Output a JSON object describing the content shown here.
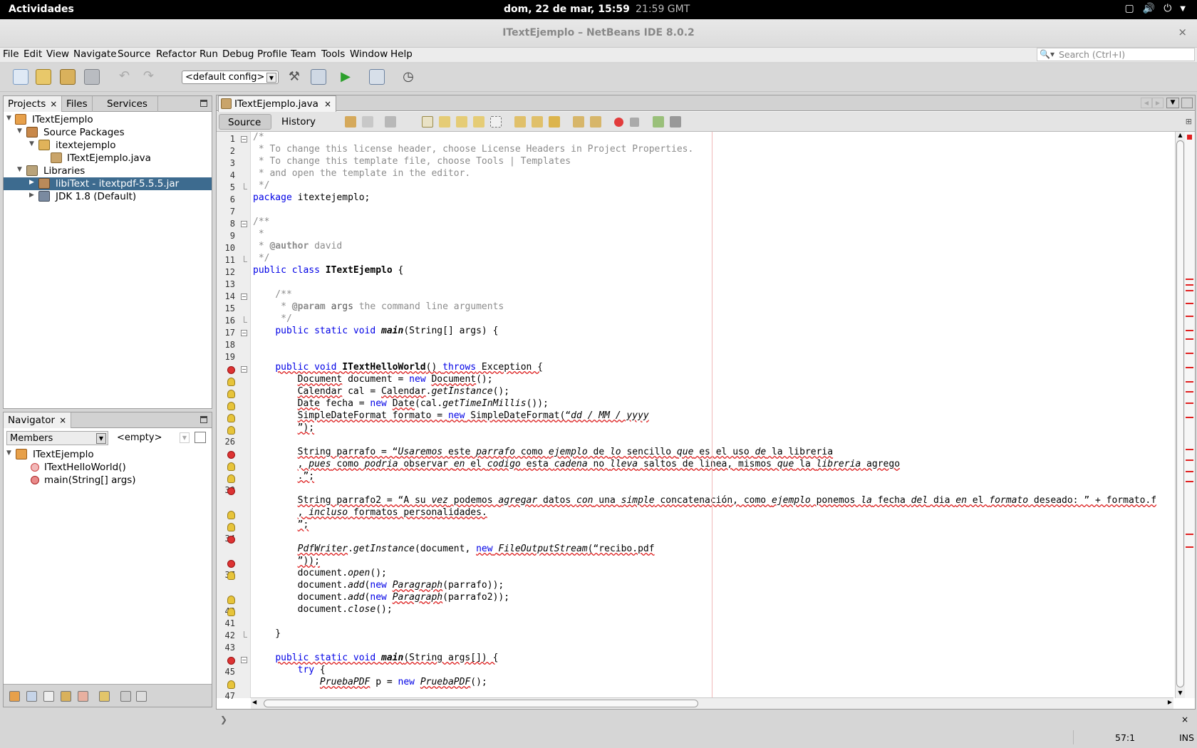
{
  "system_bar": {
    "activities": "Actividades",
    "clock": "dom, 22 de mar, 15:59",
    "gmt": "21:59 GMT"
  },
  "window": {
    "title": "ITextEjemplo – NetBeans IDE 8.0.2",
    "close": "×"
  },
  "menu": [
    "File",
    "Edit",
    "View",
    "Navigate",
    "Source",
    "Refactor",
    "Run",
    "Debug",
    "Profile",
    "Team",
    "Tools",
    "Window",
    "Help"
  ],
  "search": {
    "placeholder": "Search (Ctrl+I)"
  },
  "toolbar": {
    "config": "<default config>"
  },
  "projects_panel": {
    "tabs": [
      "Projects",
      "Files",
      "Services"
    ],
    "tree": [
      {
        "label": "ITextEjemplo"
      },
      {
        "label": "Source Packages"
      },
      {
        "label": "itextejemplo"
      },
      {
        "label": "ITextEjemplo.java"
      },
      {
        "label": "Libraries"
      },
      {
        "label": "libiText - itextpdf-5.5.5.jar"
      },
      {
        "label": "JDK 1.8 (Default)"
      }
    ]
  },
  "navigator": {
    "tab": "Navigator",
    "members": "Members",
    "empty": "<empty>",
    "tree": [
      {
        "label": "ITextEjemplo"
      },
      {
        "label": "ITextHelloWorld()"
      },
      {
        "label": "main(String[] args)"
      }
    ]
  },
  "editor": {
    "tab": "ITextEjemplo.java",
    "source_tab": "Source",
    "history_tab": "History",
    "line_numbers": [
      "1",
      "2",
      "3",
      "4",
      "5",
      "6",
      "7",
      "8",
      "9",
      "10",
      "11",
      "12",
      "13",
      "14",
      "15",
      "16",
      "17",
      "18",
      "19",
      "",
      "",
      "",
      "",
      "",
      "",
      "26",
      "",
      "",
      "",
      "30",
      "",
      "",
      "",
      "34",
      "",
      "",
      "37",
      "",
      "",
      "40",
      "41",
      "42",
      "43",
      "",
      "45",
      "",
      "47"
    ]
  },
  "status": {
    "position": "57:1",
    "mode": "INS"
  }
}
